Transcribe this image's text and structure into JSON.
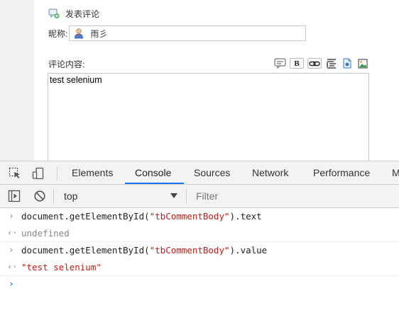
{
  "form": {
    "post_comment_label": "发表评论",
    "nickname_label": "昵称:",
    "nickname_value": "雨彡",
    "content_label": "评论内容:",
    "comment_body_text": "test selenium",
    "toolbar": {
      "bold_label": "B"
    }
  },
  "devtools": {
    "tabs": [
      "Elements",
      "Console",
      "Sources",
      "Network",
      "Performance",
      "M"
    ],
    "active_tab": "Console",
    "context_value": "top",
    "filter_placeholder": "Filter",
    "accent_color": "#1a73e8"
  },
  "console": {
    "entries": [
      {
        "kind": "input",
        "parts": [
          "document.getElementById(",
          "\"tbCommentBody\"",
          ").text"
        ]
      },
      {
        "kind": "output",
        "text": "undefined"
      },
      {
        "kind": "input",
        "parts": [
          "document.getElementById(",
          "\"tbCommentBody\"",
          ").value"
        ]
      },
      {
        "kind": "output",
        "text": "\"test selenium\""
      }
    ]
  }
}
